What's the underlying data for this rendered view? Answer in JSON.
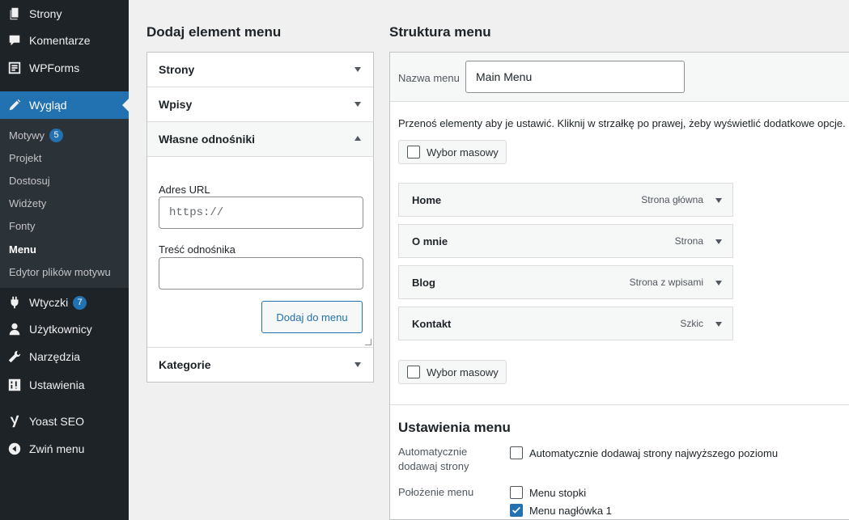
{
  "sidebar": {
    "items": [
      {
        "label": "Strony",
        "icon": "pages-icon"
      },
      {
        "label": "Komentarze",
        "icon": "comments-icon"
      },
      {
        "label": "WPForms",
        "icon": "wpforms-icon"
      },
      {
        "label": "Wygląd",
        "icon": "appearance-icon"
      },
      {
        "label": "Wtyczki",
        "icon": "plugins-icon",
        "badge": "7"
      },
      {
        "label": "Użytkownicy",
        "icon": "users-icon"
      },
      {
        "label": "Narzędzia",
        "icon": "tools-icon"
      },
      {
        "label": "Ustawienia",
        "icon": "settings-icon"
      },
      {
        "label": "Yoast SEO",
        "icon": "yoast-icon"
      },
      {
        "label": "Zwiń menu",
        "icon": "collapse-icon"
      }
    ],
    "submenu": [
      {
        "label": "Motywy",
        "badge": "5"
      },
      {
        "label": "Projekt"
      },
      {
        "label": "Dostosuj"
      },
      {
        "label": "Widżety"
      },
      {
        "label": "Fonty"
      },
      {
        "label": "Menu"
      },
      {
        "label": "Edytor plików motywu"
      }
    ]
  },
  "left": {
    "title": "Dodaj element menu",
    "sections": [
      "Strony",
      "Wpisy",
      "Własne odnośniki",
      "Kategorie"
    ],
    "url_label": "Adres URL",
    "url_placeholder": "https://",
    "link_text_label": "Treść odnośnika",
    "add_button": "Dodaj do menu"
  },
  "right": {
    "title": "Struktura menu",
    "menu_name_label": "Nazwa menu",
    "menu_name_value": "Main Menu",
    "instructions": "Przenoś elementy aby je ustawić. Kliknij w strzałkę po prawej, żeby wyświetlić dodatkowe opcje.",
    "bulk_select": "Wybor masowy",
    "items": [
      {
        "title": "Home",
        "type": "Strona główna"
      },
      {
        "title": "O mnie",
        "type": "Strona"
      },
      {
        "title": "Blog",
        "type": "Strona z wpisami"
      },
      {
        "title": "Kontakt",
        "type": "Szkic"
      }
    ],
    "settings_title": "Ustawienia menu",
    "auto_add_label_1": "Automatycznie",
    "auto_add_label_2": "dodawaj strony",
    "auto_add_option": "Automatycznie dodawaj strony najwyższego poziomu",
    "location_label": "Położenie menu",
    "locations": [
      {
        "label": "Menu stopki",
        "checked": false
      },
      {
        "label": "Menu nagłówka 1",
        "checked": true
      }
    ]
  }
}
